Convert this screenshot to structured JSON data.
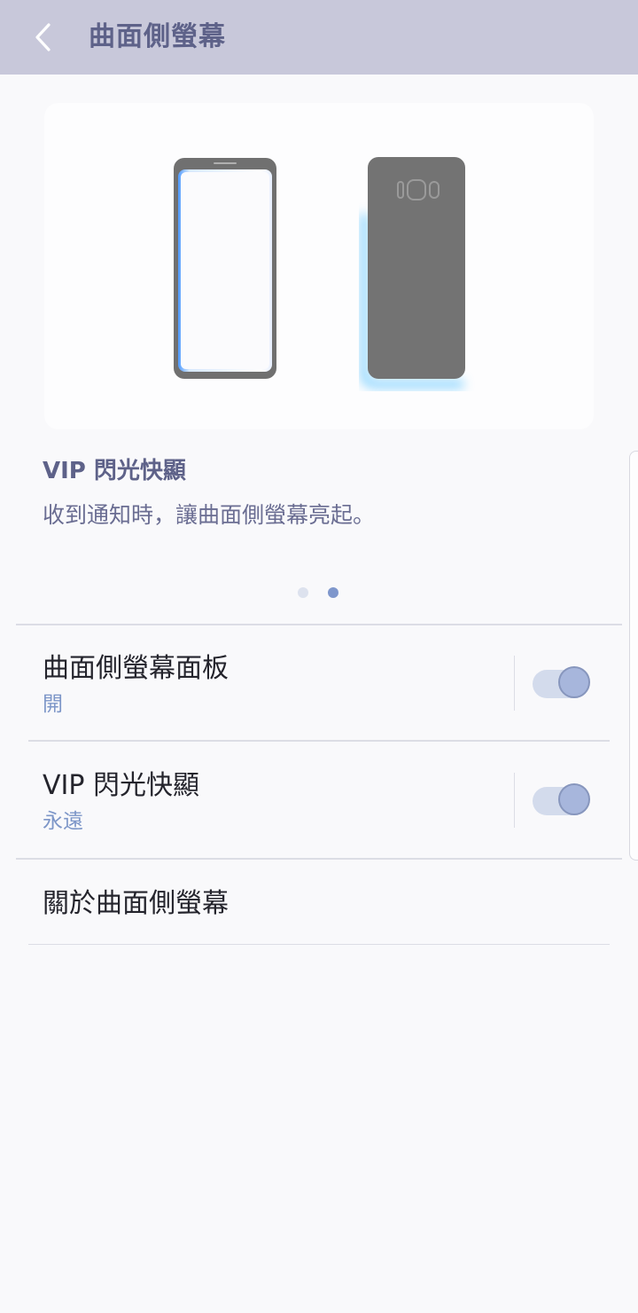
{
  "app_bar": {
    "title": "曲面側螢幕",
    "back_icon": "chevron-left-icon",
    "background": "#c8c8da",
    "title_color": "#5e6289"
  },
  "illustration": {
    "phone_front_icon": "phone-front-edge-glow-icon",
    "phone_back_icon": "phone-back-edge-glow-icon",
    "glow_color": "#7fc4ff"
  },
  "info": {
    "title": "VIP 閃光快顯",
    "description": "收到通知時，讓曲面側螢幕亮起。"
  },
  "pager": {
    "total": 2,
    "current": 2
  },
  "settings": [
    {
      "title": "曲面側螢幕面板",
      "subtitle": "開",
      "toggle_on": true
    },
    {
      "title": "VIP 閃光快顯",
      "subtitle": "永遠",
      "toggle_on": true
    },
    {
      "title": "關於曲面側螢幕"
    }
  ],
  "colors": {
    "accent": "#7d96c8",
    "toggle_track": "#d3dbec",
    "toggle_thumb": "#a7b6dc"
  }
}
